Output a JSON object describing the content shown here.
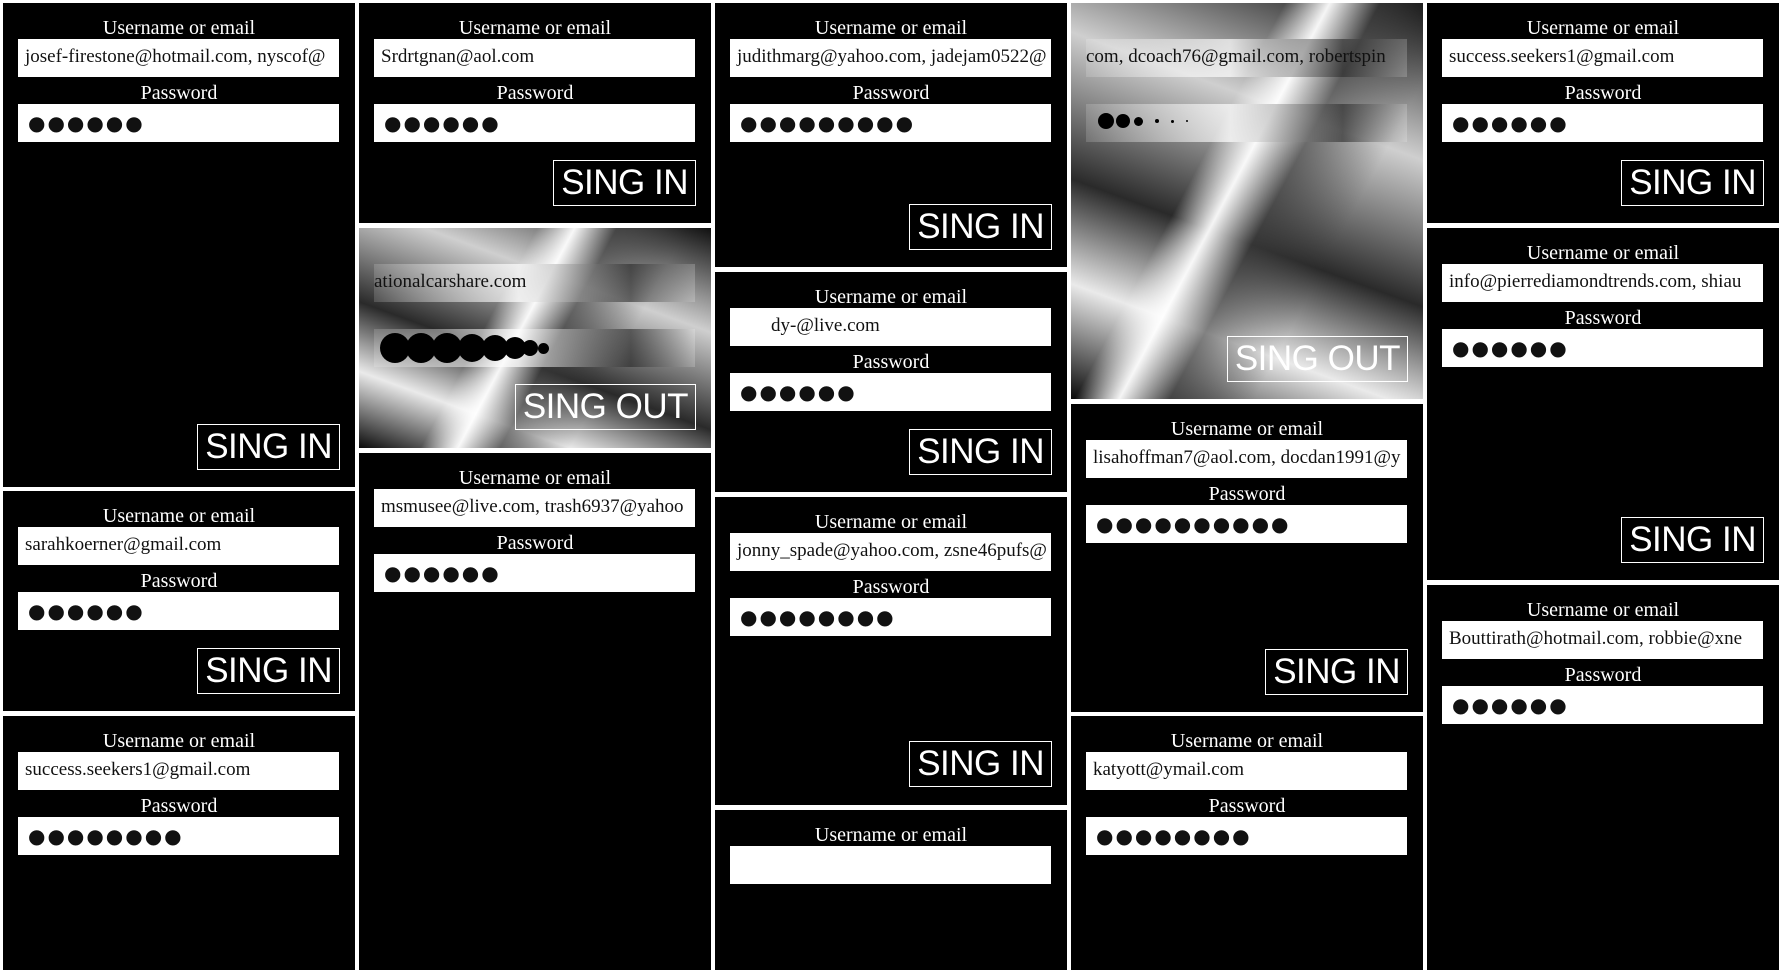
{
  "labels": {
    "username": "Username or email",
    "password": "Password",
    "sign_in": "SING IN",
    "sign_out": "SING OUT"
  },
  "cards": [
    {
      "username": "josef-firestone@hotmail.com, nyscof@",
      "password_mask": "●●●●●●"
    },
    {
      "username": "sarahkoerner@gmail.com",
      "password_mask": "●●●●●●"
    },
    {
      "username": "success.seekers1@gmail.com",
      "password_mask": "●●●●●●●●"
    },
    {
      "username": "Srdrtgnan@aol.com",
      "password_mask": "●●●●●●"
    },
    {
      "username": "ationalcarshare.com"
    },
    {
      "username": "msmusee@live.com, trash6937@yahoo",
      "password_mask": "●●●●●●"
    },
    {
      "username": "judithmarg@yahoo.com, jadejam0522@",
      "password_mask": "●●●●●●●●●"
    },
    {
      "username": "dy-@live.com",
      "password_mask": "●●●●●●"
    },
    {
      "username": "jonny_spade@yahoo.com, zsne46pufs@",
      "password_mask": "●●●●●●●●"
    },
    {
      "username": "com, dcoach76@gmail.com, robertspin"
    },
    {
      "username": "lisahoffman7@aol.com, docdan1991@y",
      "password_mask": "●●●●●●●●●●"
    },
    {
      "username": "katyott@ymail.com",
      "password_mask": "●●●●●●●●"
    },
    {
      "username": "success.seekers1@gmail.com",
      "password_mask": "●●●●●●"
    },
    {
      "username": "info@pierrediamondtrends.com, shiau",
      "password_mask": "●●●●●●"
    },
    {
      "username": "Bouttirath@hotmail.com, robbie@xne",
      "password_mask": "●●●●●●"
    }
  ]
}
